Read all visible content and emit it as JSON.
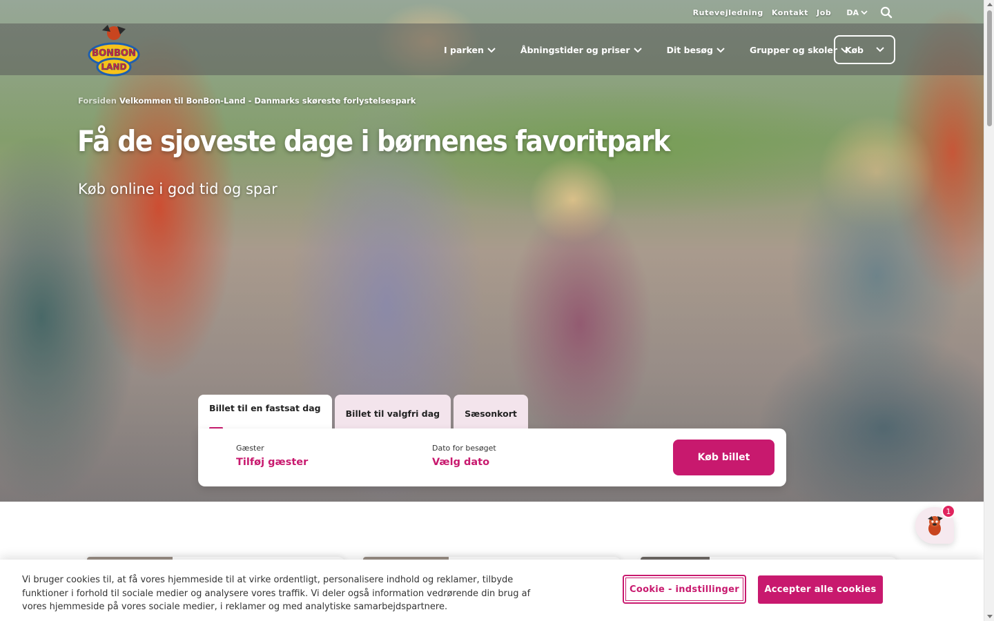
{
  "utility": {
    "links": [
      "Rutevejledning",
      "Kontakt",
      "Job"
    ],
    "language": "DA"
  },
  "logo": {
    "text_line1": "BONBON",
    "text_line2": "LAND"
  },
  "nav": {
    "items": [
      "I parken",
      "Åbningstider og priser",
      "Dit besøg",
      "Grupper og skoler"
    ],
    "buy_label": "Køb"
  },
  "hero": {
    "breadcrumb_home": "Forsiden",
    "breadcrumb_current": "Velkommen til BonBon-Land - Danmarks skøreste forlystelsespark",
    "title": "Få de sjoveste dage i børnenes favoritpark",
    "subtitle": "Køb online i god tid og spar"
  },
  "booking": {
    "tabs": [
      "Billet til en fastsat dag",
      "Billet til valgfri dag",
      "Sæsonkort"
    ],
    "active_tab": 0,
    "guests_label": "Gæster",
    "guests_value": "Tilføj gæster",
    "date_label": "Dato for besøget",
    "date_value": "Vælg dato",
    "cta": "Køb billet"
  },
  "chat": {
    "badge": "1"
  },
  "cookie": {
    "text": "Vi bruger cookies til, at få vores hjemmeside til at virke ordentligt, personalisere indhold og reklamer, tilbyde funktioner i forhold til sociale medier og analysere vores traffik. Vi deler også information vedrørende din brug af vores hjemmeside på vores sociale medier, i reklamer og med analytiske samarbejdspartnere.",
    "settings_label": "Cookie - indstillinger",
    "accept_label": "Accepter alle cookies"
  },
  "colors": {
    "brand": "#c8196e",
    "tab_inactive": "#f3e4ec",
    "nav_overlay": "rgba(90,90,90,0.55)"
  }
}
